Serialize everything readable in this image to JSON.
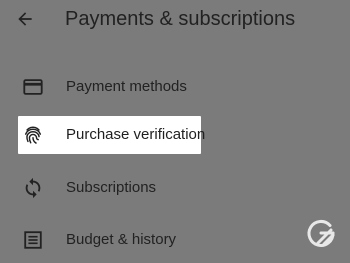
{
  "header": {
    "back_icon": "arrow-back-icon",
    "title": "Payments & subscriptions"
  },
  "menu": {
    "items": [
      {
        "label": "Payment methods",
        "icon": "credit-card-icon",
        "highlighted": false
      },
      {
        "label": "Purchase verification",
        "icon": "fingerprint-icon",
        "highlighted": true
      },
      {
        "label": "Subscriptions",
        "icon": "refresh-icon",
        "highlighted": false
      },
      {
        "label": "Budget & history",
        "icon": "list-icon",
        "highlighted": false
      }
    ]
  },
  "watermark": {
    "icon": "logo-watermark-icon"
  },
  "colors": {
    "background": "#7b7b7b",
    "highlight": "#ffffff",
    "text": "#222222"
  }
}
